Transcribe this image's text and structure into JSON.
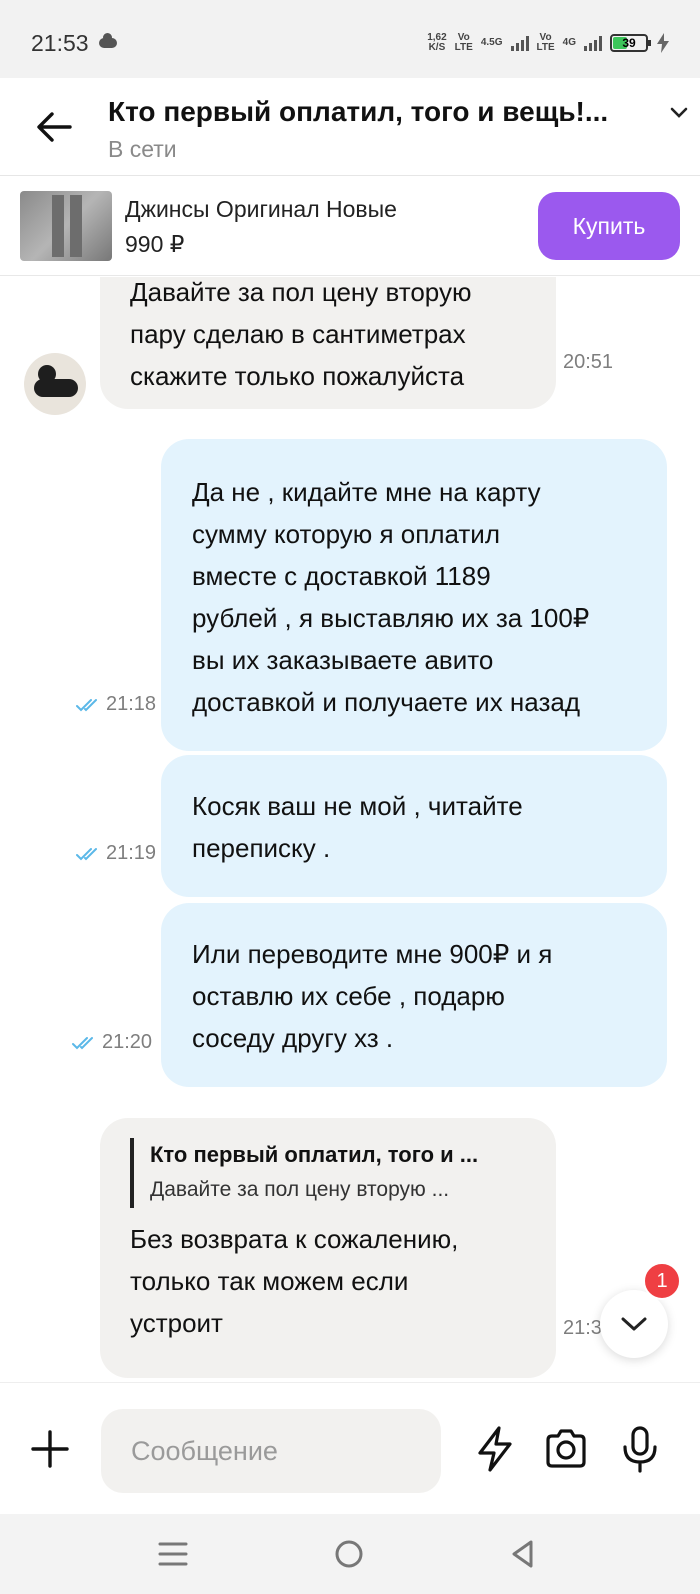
{
  "status_bar": {
    "time": "21:53",
    "net_speed_value": "1,62",
    "net_speed_unit": "K/S",
    "sim1_top": "Vo",
    "sim1_bottom": "LTE",
    "sim1_gen": "4.5G",
    "sim2_top": "Vo",
    "sim2_bottom": "LTE",
    "sim2_gen": "4G",
    "battery": "39",
    "icons": [
      "cloud-icon",
      "signal-icon",
      "battery-icon",
      "charging-icon"
    ]
  },
  "header": {
    "title": "Кто первый оплатил, того и вещь!...",
    "status": "В сети",
    "icons": [
      "arrow-left-icon",
      "chevron-down-icon"
    ]
  },
  "product": {
    "name": "Джинсы Оригинал Новые",
    "price": "990 ₽",
    "buy_label": "Купить"
  },
  "messages": [
    {
      "side": "in",
      "text": "Давайте за пол цену вторую\nпару сделаю в сантиметрах\nскажите только пожалуйста",
      "time": "20:51"
    },
    {
      "side": "out",
      "text": "Да не , кидайте мне на карту\nсумму которую я оплатил\nвместе с доставкой 1189\nрублей , я выставляю их за 100₽\nвы их заказываете авито\nдоставкой и получаете их назад",
      "time": "21:18",
      "read": true
    },
    {
      "side": "out",
      "text": "Косяк ваш не мой , читайте\nпереписку .",
      "time": "21:19",
      "read": true
    },
    {
      "side": "out",
      "text": "Или переводите мне 900₽ и я\nоставлю их себе , подарю\nсоседу другу хз .",
      "time": "21:20",
      "read": true
    },
    {
      "side": "in",
      "quote_title": "Кто первый оплатил, того и ...",
      "quote_text": "Давайте за пол цену вторую ...",
      "text": "Без возврата к сожалению,\nтолько так можем если\nустроит",
      "time": "21:38"
    }
  ],
  "scroll_badge": "1",
  "composer": {
    "placeholder": "Сообщение",
    "icons": [
      "plus-icon",
      "lightning-icon",
      "camera-icon",
      "microphone-icon"
    ]
  },
  "nav": {
    "icons": [
      "menu-icon",
      "home-icon",
      "back-icon"
    ]
  },
  "colors": {
    "accent": "#9b59ee",
    "incoming_bubble": "#f2f1ef",
    "outgoing_bubble": "#e3f3fd",
    "read_ticks": "#5bb8e8",
    "badge": "#ef3f43"
  }
}
